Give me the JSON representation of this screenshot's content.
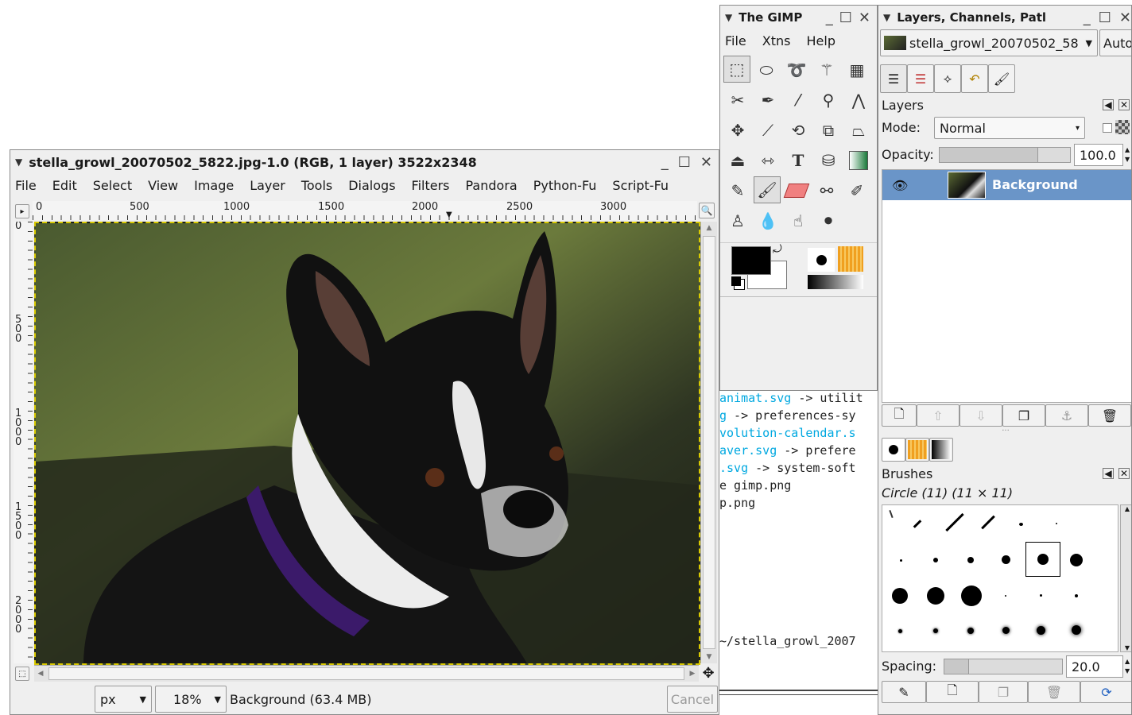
{
  "image_window": {
    "title": "stella_growl_20070502_5822.jpg-1.0 (RGB, 1 layer) 3522x2348",
    "menu": [
      "File",
      "Edit",
      "Select",
      "View",
      "Image",
      "Layer",
      "Tools",
      "Dialogs",
      "Filters",
      "Pandora",
      "Python-Fu",
      "Script-Fu"
    ],
    "ruler_h": [
      "0",
      "500",
      "1000",
      "1500",
      "2000",
      "2500",
      "3000"
    ],
    "ruler_v": [
      "0",
      "500",
      "1000",
      "1500",
      "2000"
    ],
    "status": {
      "unit": "px",
      "zoom": "18%",
      "info": "Background (63.4 MB)",
      "cancel": "Cancel"
    }
  },
  "toolbox": {
    "title": "The GIMP",
    "menu": [
      "File",
      "Xtns",
      "Help"
    ],
    "tool_icons": [
      "rect-select-icon",
      "ellipse-select-icon",
      "lasso-icon",
      "fuzzy-select-icon",
      "color-select-icon",
      "scissors-icon",
      "paths-icon",
      "color-picker-icon",
      "zoom-icon",
      "measure-icon",
      "move-icon",
      "crop-icon",
      "rotate-icon",
      "scale-icon",
      "perspective-icon",
      "flip-icon",
      "align-icon",
      "text-icon",
      "bucket-fill-icon",
      "blend-icon",
      "pencil-icon",
      "paintbrush-icon",
      "eraser-icon",
      "airbrush-icon",
      "ink-icon",
      "clone-icon",
      "blur-icon",
      "smudge-icon",
      "dodge-icon"
    ],
    "colors": {
      "foreground": "#000000",
      "background": "#ffffff"
    }
  },
  "terminal": {
    "lines": [
      {
        "pre": "",
        "cyan": "animat.svg",
        "post": " -> utilit"
      },
      {
        "pre": "",
        "cyan": "g",
        "post": " -> preferences-sy"
      },
      {
        "pre": "",
        "cyan": "volution-calendar.s",
        "post": ""
      },
      {
        "pre": "",
        "cyan": "aver.svg",
        "post": " -> prefere"
      },
      {
        "pre": "",
        "cyan": ".svg",
        "post": " -> system-soft"
      },
      {
        "pre": "e gimp.png",
        "cyan": "",
        "post": ""
      },
      {
        "pre": "p.png",
        "cyan": "",
        "post": ""
      }
    ],
    "path_line": "~/stella_growl_2007"
  },
  "layers_window": {
    "title": "Layers, Channels, Patl",
    "image_select": "stella_growl_20070502_58",
    "auto_label": "Auto",
    "layers_label": "Layers",
    "mode_label": "Mode:",
    "mode_value": "Normal",
    "opacity_label": "Opacity:",
    "opacity_value": "100.0",
    "opacity": 1.0,
    "layer_name": "Background",
    "brushes_label": "Brushes",
    "brush_name": "Circle (11) (11 × 11)",
    "spacing_label": "Spacing:",
    "spacing_value": "20.0",
    "spacing": 0.2
  }
}
